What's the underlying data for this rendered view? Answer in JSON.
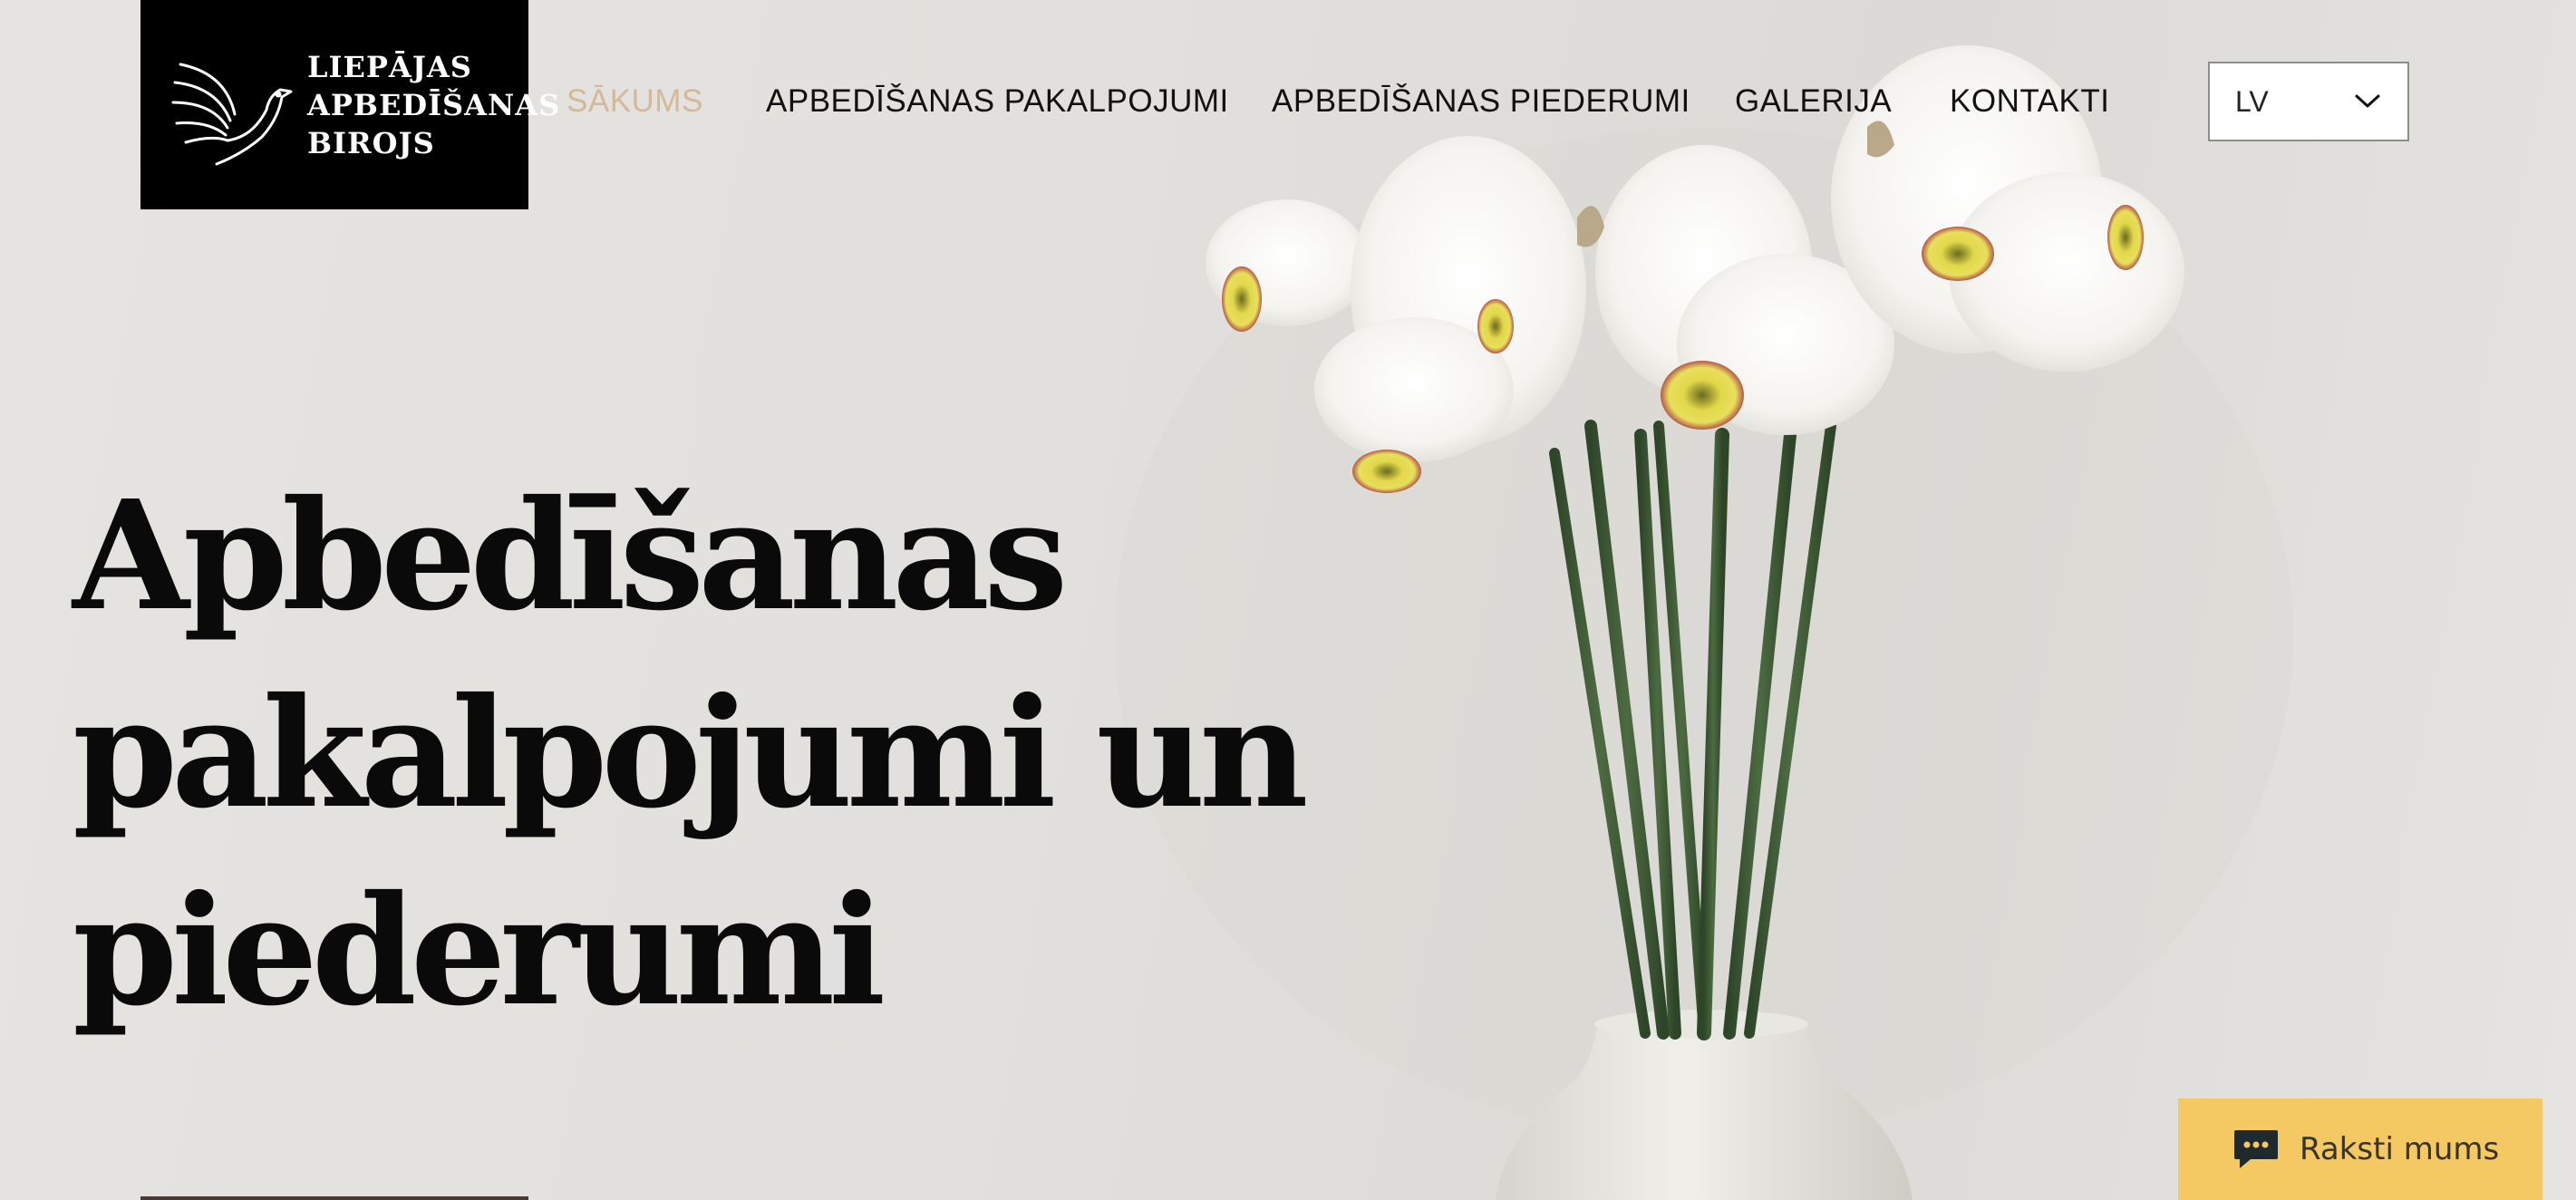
{
  "logo": {
    "lines": [
      "LIEPĀJAS",
      "APBEDĪŠANAS",
      "BIROJS"
    ],
    "icon": "dove-icon"
  },
  "nav": {
    "items": [
      {
        "label": "SĀKUMS",
        "active": true
      },
      {
        "label": "APBEDĪŠANAS PAKALPOJUMI",
        "active": false
      },
      {
        "label": "APBEDĪŠANAS PIEDERUMI",
        "active": false
      },
      {
        "label": "GALERIJA",
        "active": false
      },
      {
        "label": "KONTAKTI",
        "active": false
      }
    ]
  },
  "language": {
    "selected": "LV",
    "icon": "chevron-down-icon"
  },
  "hero": {
    "title_lines": [
      "Apbedīšanas",
      "pakalpojumi un",
      "piederumi"
    ],
    "image": "white-daffodils-in-vase"
  },
  "chat": {
    "label": "Raksti mums",
    "icon": "chat-bubble-icon"
  },
  "colors": {
    "background": "#e2e0dd",
    "nav_active": "#d3b999",
    "chat_button": "#f4c862",
    "logo_bg": "#000000",
    "stem_green": "#3f5a36"
  }
}
